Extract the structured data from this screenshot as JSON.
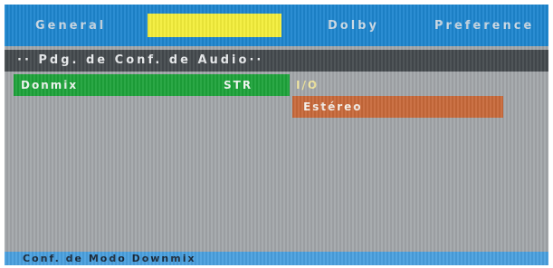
{
  "tabs": {
    "general": "General",
    "active": "",
    "dolby": "Dolby",
    "preference": "Preference"
  },
  "subtitle": "·· Pdg. de Conf. de Audio··",
  "menu": {
    "item_label": "Donmix",
    "item_value": "STR",
    "io_label": "I/O",
    "option": "Estéreo"
  },
  "footer": "Conf. de Modo Downmix",
  "colors": {
    "tab_bar": "#1e86cf",
    "active_tab": "#f3ee3b",
    "selected_item": "#1ea33a",
    "option_highlight": "#c8693a",
    "background": "#a3a7aa"
  }
}
